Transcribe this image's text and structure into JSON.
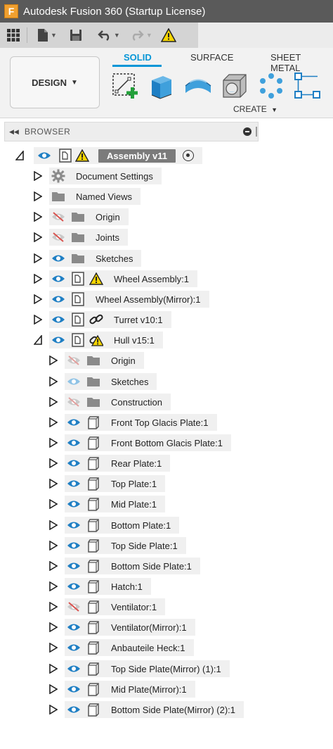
{
  "window": {
    "title": "Autodesk Fusion 360 (Startup License)",
    "logo_letter": "F"
  },
  "ribbon": {
    "workspace_label": "DESIGN",
    "tabs": [
      {
        "label": "SOLID",
        "active": true
      },
      {
        "label": "SURFACE",
        "active": false
      },
      {
        "label": "SHEET METAL",
        "active": false
      }
    ],
    "create_label": "CREATE"
  },
  "browser": {
    "title": "BROWSER",
    "root": {
      "label": "Assembly v11",
      "icons": [
        "eye-icon",
        "component-icon",
        "warning-icon"
      ]
    },
    "items": [
      {
        "label": "Document Settings",
        "depth": 1,
        "eye": "none",
        "icon": "gear-icon"
      },
      {
        "label": "Named Views",
        "depth": 1,
        "eye": "none",
        "icon": "folder-icon"
      },
      {
        "label": "Origin",
        "depth": 1,
        "eye": "hidden",
        "icon": "folder-icon"
      },
      {
        "label": "Joints",
        "depth": 1,
        "eye": "hidden",
        "icon": "folder-icon"
      },
      {
        "label": "Sketches",
        "depth": 1,
        "eye": "visible",
        "icon": "folder-icon"
      },
      {
        "label": "Wheel Assembly:1",
        "depth": 1,
        "eye": "visible",
        "icon": "component-icon",
        "badge": "warning-icon"
      },
      {
        "label": "Wheel Assembly(Mirror):1",
        "depth": 1,
        "eye": "visible",
        "icon": "component-icon"
      },
      {
        "label": "Turret v10:1",
        "depth": 1,
        "eye": "visible",
        "icon": "component-icon",
        "badge": "link-icon"
      },
      {
        "label": "Hull v15:1",
        "depth": 1,
        "eye": "visible",
        "icon": "component-icon",
        "badge": "warning-link-icon",
        "expanded": true
      },
      {
        "label": "Origin",
        "depth": 2,
        "eye": "hidden-light",
        "icon": "folder-icon"
      },
      {
        "label": "Sketches",
        "depth": 2,
        "eye": "visible-light",
        "icon": "folder-icon"
      },
      {
        "label": "Construction",
        "depth": 2,
        "eye": "hidden-light",
        "icon": "folder-icon"
      },
      {
        "label": "Front Top Glacis Plate:1",
        "depth": 2,
        "eye": "visible",
        "icon": "body-icon"
      },
      {
        "label": "Front Bottom Glacis Plate:1",
        "depth": 2,
        "eye": "visible",
        "icon": "body-icon"
      },
      {
        "label": "Rear Plate:1",
        "depth": 2,
        "eye": "visible",
        "icon": "body-icon"
      },
      {
        "label": "Top Plate:1",
        "depth": 2,
        "eye": "visible",
        "icon": "body-icon"
      },
      {
        "label": "Mid Plate:1",
        "depth": 2,
        "eye": "visible",
        "icon": "body-icon"
      },
      {
        "label": "Bottom Plate:1",
        "depth": 2,
        "eye": "visible",
        "icon": "body-icon"
      },
      {
        "label": "Top Side Plate:1",
        "depth": 2,
        "eye": "visible",
        "icon": "body-icon"
      },
      {
        "label": "Bottom Side Plate:1",
        "depth": 2,
        "eye": "visible",
        "icon": "body-icon"
      },
      {
        "label": "Hatch:1",
        "depth": 2,
        "eye": "visible",
        "icon": "body-icon"
      },
      {
        "label": "Ventilator:1",
        "depth": 2,
        "eye": "hidden",
        "icon": "body-icon"
      },
      {
        "label": "Ventilator(Mirror):1",
        "depth": 2,
        "eye": "visible",
        "icon": "body-icon"
      },
      {
        "label": "Anbauteile Heck:1",
        "depth": 2,
        "eye": "visible",
        "icon": "body-icon"
      },
      {
        "label": "Top Side Plate(Mirror) (1):1",
        "depth": 2,
        "eye": "visible",
        "icon": "body-icon"
      },
      {
        "label": "Mid Plate(Mirror):1",
        "depth": 2,
        "eye": "visible",
        "icon": "body-icon"
      },
      {
        "label": "Bottom Side Plate(Mirror) (2):1",
        "depth": 2,
        "eye": "visible",
        "icon": "body-icon"
      }
    ]
  },
  "colors": {
    "accent": "#0696d7",
    "eye_visible": "#1f7fc4",
    "eye_light": "#8fc3e6",
    "eye_hidden": "#d9534f",
    "warning": "#f5d400",
    "titlebar": "#5a5a5a"
  }
}
